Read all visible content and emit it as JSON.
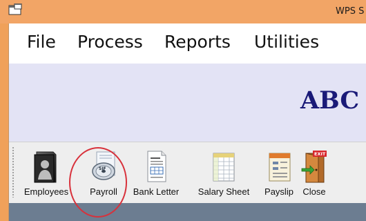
{
  "window": {
    "title": "WPS S"
  },
  "menu": {
    "items": [
      "File",
      "Process",
      "Reports",
      "Utilities"
    ]
  },
  "banner": {
    "text": "ABC"
  },
  "toolbar": {
    "buttons": [
      {
        "label": "Employees",
        "icon": "employees-folder-icon"
      },
      {
        "label": "Payroll",
        "icon": "payroll-sif-disc-icon"
      },
      {
        "label": "Bank Letter",
        "icon": "bank-letter-document-icon"
      },
      {
        "label": "Salary Sheet",
        "icon": "salary-sheet-spreadsheet-icon"
      },
      {
        "label": "Payslip",
        "icon": "payslip-notepad-icon"
      },
      {
        "label": "Close",
        "icon": "exit-door-icon"
      }
    ]
  },
  "annotation": {
    "highlighted_item": "Payroll",
    "circle_color": "#d8313b"
  },
  "colors": {
    "titlebar": "#f2a566",
    "banner_text": "#1a1a78",
    "lower_area": "#6c7d91"
  }
}
